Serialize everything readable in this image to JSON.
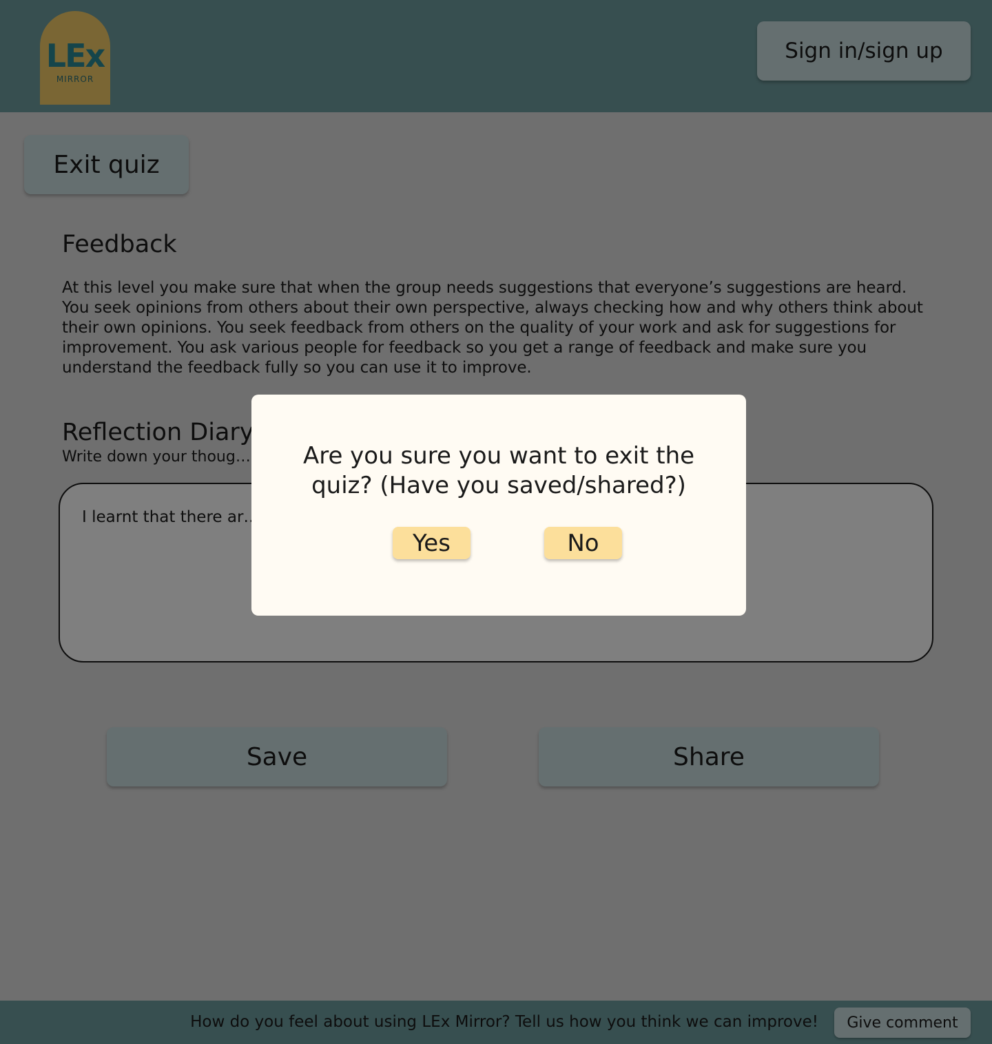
{
  "header": {
    "logo": {
      "mark": "LEx",
      "sub": "MIRROR"
    },
    "signin_label": "Sign in/sign up"
  },
  "exit_quiz_label": "Exit quiz",
  "feedback": {
    "title": "Feedback",
    "text": "At this level you make sure that when the group needs suggestions that everyone’s suggestions are heard. You seek opinions from others about their own perspective, always checking how and why others think about their own opinions. You seek feedback from others on the quality of your work and ask for suggestions for improvement. You ask various people for feedback so you get a range of feedback and make sure you understand the feedback fully so you can use it to improve."
  },
  "diary": {
    "title": "Reflection Diary",
    "prompt": "Write down your thoug… o to improve?",
    "text": "I learnt that there  ar… g. I will try to speak up more often and b…"
  },
  "actions": {
    "save_label": "Save",
    "share_label": "Share"
  },
  "footer": {
    "text": "How do you feel about using LEx Mirror? Tell us how you think we can improve!",
    "comment_label": "Give comment"
  },
  "modal": {
    "question": "Are you sure you want to exit the quiz? (Have you saved/shared?)",
    "yes_label": "Yes",
    "no_label": "No"
  },
  "colors": {
    "header_bg": "#6f9ea0",
    "button_bg": "#cadfe0",
    "modal_button_bg": "#fcdf9b",
    "logo_bg": "#f4cd68"
  }
}
